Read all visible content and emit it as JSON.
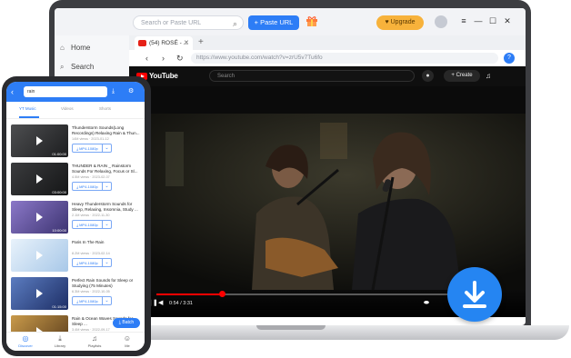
{
  "app": {
    "search_placeholder": "Search or Paste URL",
    "paste_url_label": "+ Paste URL",
    "upgrade_label": "Upgrade",
    "window_controls": [
      "≡",
      "—",
      "☐",
      "✕"
    ]
  },
  "sidebar": {
    "items": [
      {
        "label": "Home"
      },
      {
        "label": "Search"
      }
    ]
  },
  "browser": {
    "tab_title": "(54) ROSÉ - ...",
    "tab_close": "✕",
    "new_tab": "+",
    "url": "https://www.youtube.com/watch?v=zrU5v7Tu6fo"
  },
  "youtube": {
    "logo_text": "YouTube",
    "search_placeholder": "Search",
    "create_label": "+ Create"
  },
  "player": {
    "time": "0:54 / 3:31",
    "progress_fraction": 0.22
  },
  "phone": {
    "search_value": "rain",
    "tabs": [
      "YT Music",
      "Videos",
      "Shorts"
    ],
    "active_tab": 0,
    "items": [
      {
        "title": "Thunderstorm Sounds(Long Recordings) Relaxing Rain & Thun...",
        "meta": "14M views · 2023-01-12",
        "duration": "01:00:00",
        "quality": "MP4-1080p",
        "color1": "#4d4e50",
        "color2": "#1d1e20"
      },
      {
        "title": "THUNDER & RAIN _ Rainstorm Sounds For Relaxing, Focus or Sl...",
        "meta": "4.5M views · 2023-02-07",
        "duration": "03:00:00",
        "quality": "MP4-1080p",
        "color1": "#3a3b3d",
        "color2": "#151617"
      },
      {
        "title": "Heavy Thunderstorm Sounds for Sleep, Relaxing, Insomnia, Study ...",
        "meta": "2.1M views · 2022-11-30",
        "duration": "10:00:00",
        "quality": "MP4-1080p",
        "color1": "#8b78c8",
        "color2": "#3d3472"
      },
      {
        "title": "Paris In The Rain",
        "meta": "8.2M views · 2023-02-14",
        "duration": "",
        "quality": "MP4-1080p",
        "color1": "#e8f2fb",
        "color2": "#a8c8e8"
      },
      {
        "title": "Perfect Rain Sounds for Sleep or Studying (75 Minutes)",
        "meta": "6.3M views · 2022-10-05",
        "duration": "01:15:00",
        "quality": "MP4-1080p",
        "color1": "#5b7cc0",
        "color2": "#1e2f66"
      },
      {
        "title": "Rain & Ocean Waves Sounds for Sleep ...",
        "meta": "3.4M views · 2022-09-17",
        "duration": "01:00:00",
        "quality": "MP4-1080p",
        "color1": "#c99a4a",
        "color2": "#5a3d1c"
      }
    ],
    "batch_label": "Batch",
    "nav": [
      "Discover",
      "Library",
      "Playlists",
      "Me"
    ]
  },
  "colors": {
    "accent": "#2d7df6",
    "youtube_red": "#ff0000",
    "upgrade": "#f7b23b"
  }
}
